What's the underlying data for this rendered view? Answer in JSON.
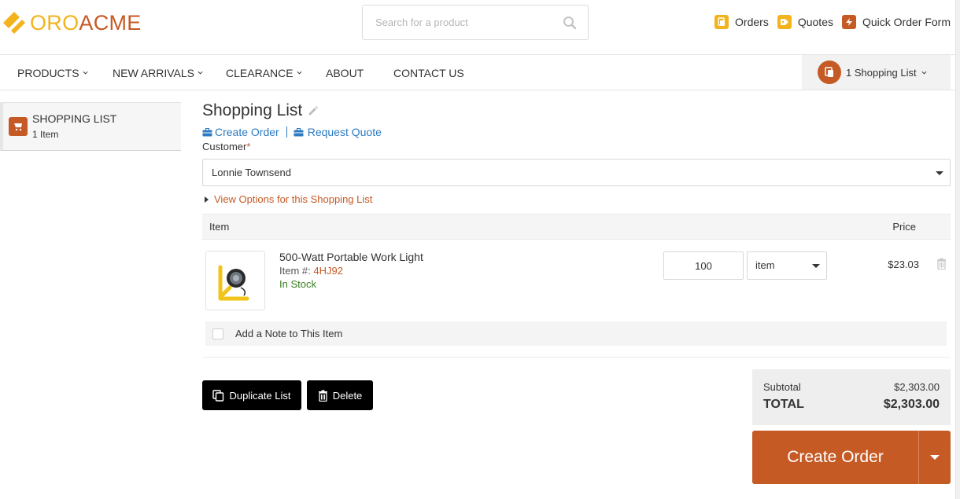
{
  "brand": {
    "part1": "ORO",
    "part2": "ACME",
    "color_primary": "#f2b31d",
    "color_secondary": "#c55a25"
  },
  "search": {
    "placeholder": "Search for a product"
  },
  "top_links": [
    {
      "label": "Orders",
      "icon": "orders-icon",
      "color": "#f2b31d"
    },
    {
      "label": "Quotes",
      "icon": "quotes-icon",
      "color": "#f2b31d"
    },
    {
      "label": "Quick Order Form",
      "icon": "quick-order-icon",
      "color": "#c55a25"
    }
  ],
  "nav": {
    "items": [
      {
        "label": "PRODUCTS",
        "dropdown": true
      },
      {
        "label": "NEW ARRIVALS",
        "dropdown": true
      },
      {
        "label": "CLEARANCE",
        "dropdown": true
      },
      {
        "label": "ABOUT",
        "dropdown": false
      },
      {
        "label": "CONTACT US",
        "dropdown": false
      }
    ],
    "shopping_list_button": "1 Shopping List"
  },
  "sidebar": {
    "title": "SHOPPING LIST",
    "count": "1 Item"
  },
  "page": {
    "title": "Shopping List",
    "create_order_link": "Create Order",
    "request_quote_link": "Request Quote",
    "customer_label": "Customer",
    "required_mark": "*",
    "customer_value": "Lonnie Townsend",
    "view_options": "View Options for this Shopping List"
  },
  "table": {
    "headers": {
      "item": "Item",
      "price": "Price"
    },
    "rows": [
      {
        "name": "500-Watt Portable Work Light",
        "sku_label": "Item #:",
        "sku": "4HJ92",
        "stock": "In Stock",
        "quantity": "100",
        "unit": "item",
        "price": "$23.03"
      }
    ],
    "note_label": "Add a Note to This Item"
  },
  "buttons": {
    "duplicate": "Duplicate List",
    "delete": "Delete"
  },
  "totals": {
    "subtotal_label": "Subtotal",
    "subtotal_value": "$2,303.00",
    "total_label": "TOTAL",
    "total_value": "$2,303.00"
  },
  "checkout": {
    "create_order_label": "Create Order"
  }
}
